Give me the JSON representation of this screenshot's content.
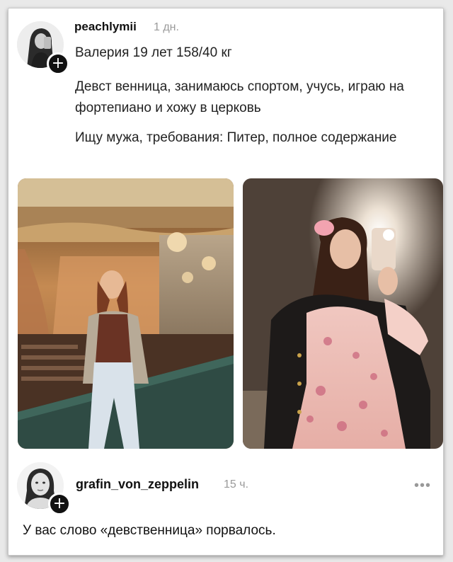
{
  "post": {
    "username": "peachlymii",
    "time": "1 дн.",
    "line1": "Валерия 19 лет 158/40 кг",
    "para2": "Девст  венница, занимаюсь спортом, учусь, играю на фортепиано и хожу в церковь",
    "para3": "Ищу мужа, требования: Питер, полное содержание",
    "follow_symbol": "+"
  },
  "reply": {
    "username": "grafin_von_zeppelin",
    "time": "15 ч.",
    "more": "•••",
    "text": "У вас слово «девственница» порвалось.",
    "follow_symbol": "+"
  }
}
